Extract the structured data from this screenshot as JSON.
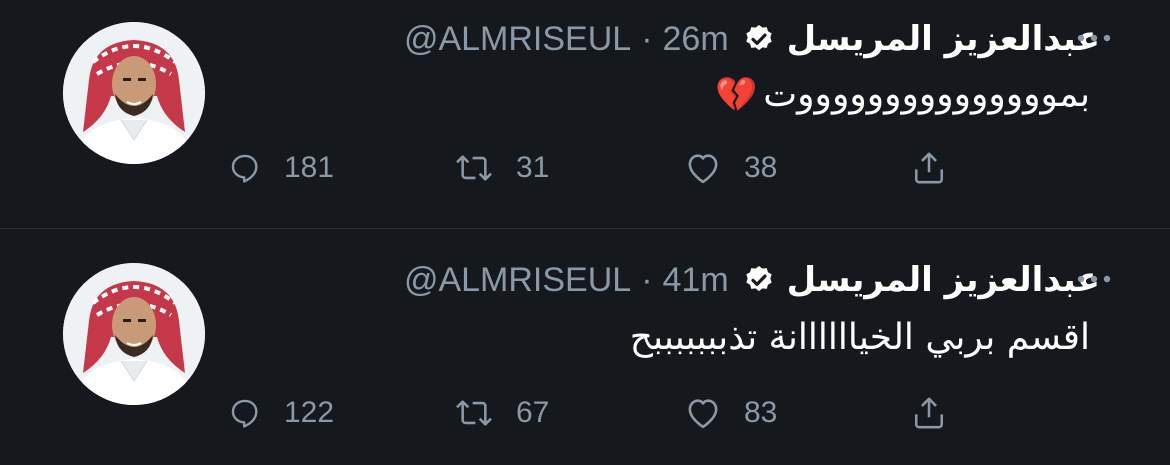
{
  "tweets": [
    {
      "display_name": "عبدالعزيز المريسل",
      "handle": "@ALMRISEUL",
      "separator": "·",
      "time": "26m",
      "text": "بموووووووووووووووت",
      "emoji": "💔",
      "replies": "181",
      "retweets": "31",
      "likes": "38"
    },
    {
      "display_name": "عبدالعزيز المريسل",
      "handle": "@ALMRISEUL",
      "separator": "·",
      "time": "41m",
      "text": "اقسم بربي الخياااااانة تذبببببببح",
      "emoji": "",
      "replies": "122",
      "retweets": "67",
      "likes": "83"
    }
  ],
  "colors": {
    "background": "#15181d",
    "text": "#ffffff",
    "muted": "#8b98a5",
    "divider": "#2a2f36"
  },
  "icons": [
    "more-icon",
    "verified-badge-icon",
    "reply-icon",
    "retweet-icon",
    "like-icon",
    "share-icon",
    "broken-heart-emoji"
  ]
}
